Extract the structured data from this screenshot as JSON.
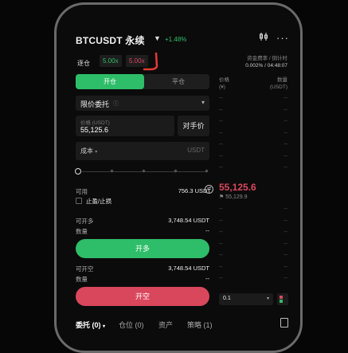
{
  "header": {
    "title": "BTCUSDT 永续",
    "change": "+1.48%"
  },
  "margin": {
    "mode": "逐仓",
    "long_leverage": "5.00x",
    "short_leverage": "5.00x"
  },
  "funding": {
    "label": "资金费率 / 倒计时",
    "value": "0.002% / 04:48:07"
  },
  "tabs": {
    "open": "开仓",
    "close": "平仓"
  },
  "order_type": "限价委托",
  "price": {
    "label": "价格 (USDT)",
    "value": "55,125.6",
    "counter_label": "对手价"
  },
  "cost": {
    "label": "成本",
    "unit": "USDT"
  },
  "available": {
    "label": "可用",
    "value": "756.3 USDT"
  },
  "tpsl_label": "止盈/止损",
  "long_side": {
    "can_open_label": "可开多",
    "can_open_value": "3,748.54 USDT",
    "qty_label": "数量",
    "qty_value": "--",
    "button": "开多"
  },
  "short_side": {
    "can_open_label": "可开空",
    "can_open_value": "3,748.54 USDT",
    "qty_label": "数量",
    "qty_value": "--",
    "button": "开空"
  },
  "orderbook": {
    "price_header": "价格",
    "price_unit": "(¥)",
    "qty_header": "数量",
    "qty_unit": "(USDT)",
    "mark_price": "55,125.6",
    "index_price": "55,129.9",
    "depth_value": "0.1",
    "row_placeholder": "--"
  },
  "bottom_tabs": {
    "orders": "委托 (0)",
    "positions": "仓位 (0)",
    "assets": "资产",
    "strategy": "策略 (1)"
  },
  "colors": {
    "green": "#2ebd68",
    "red": "#d9475d"
  }
}
